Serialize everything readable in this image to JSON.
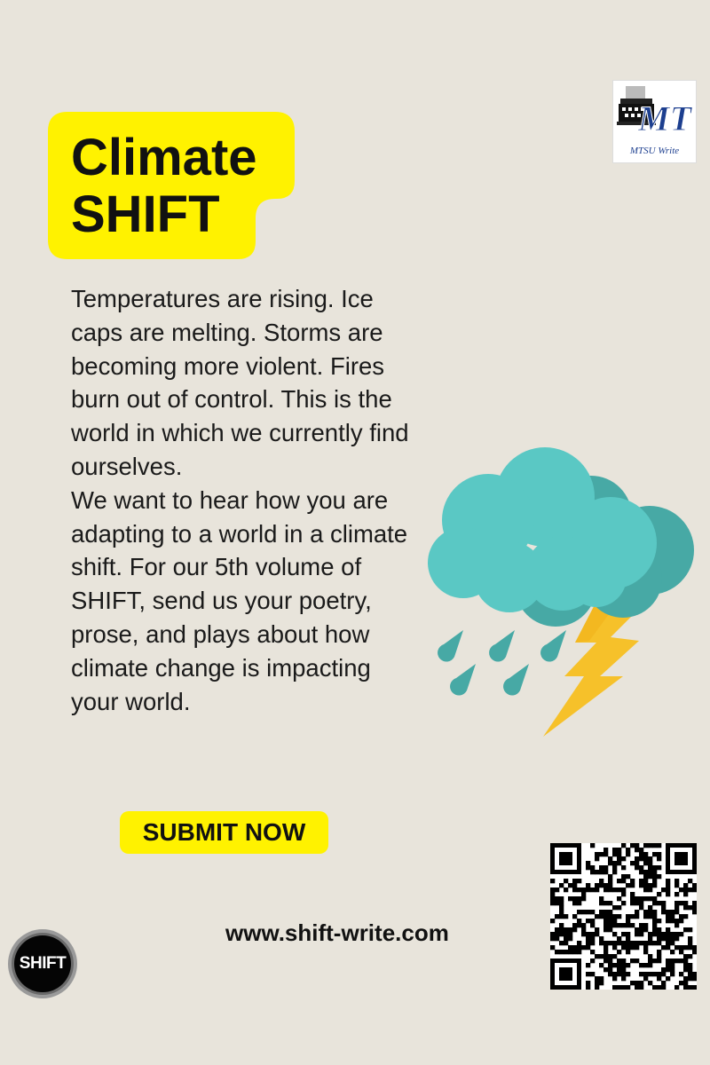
{
  "title": {
    "line1": "Climate",
    "line2": "SHIFT",
    "bg_color": "#fff200"
  },
  "logo": {
    "caption": "MTSU Write",
    "mark": "MT",
    "icon": "typewriter-icon"
  },
  "body": {
    "paragraph1": "Temperatures are rising. Ice caps are melting. Storms are becoming more violent. Fires burn out of control. This is the world in which we currently find ourselves.",
    "paragraph2": "We want to hear how you are adapting to a world in a climate shift. For our 5th volume of SHIFT, send us your poetry, prose, and plays about how climate change is impacting your world."
  },
  "illustration": {
    "icon": "storm-cloud-icon",
    "cloud_color": "#5ac8c4",
    "bolt_color": "#f6c12a"
  },
  "submit": {
    "label": "SUBMIT NOW"
  },
  "website": {
    "label": "www.shift-write.com"
  },
  "qr": {
    "icon": "qr-code-icon"
  },
  "shift_logo": {
    "label": "SHIFT"
  }
}
